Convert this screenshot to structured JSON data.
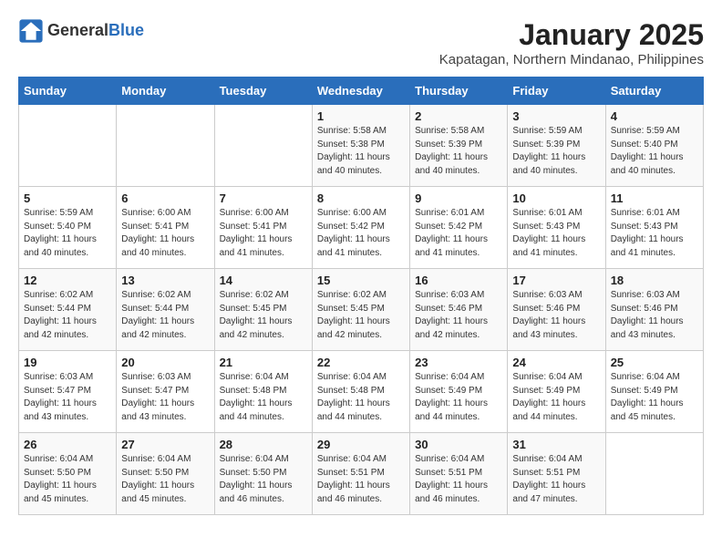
{
  "header": {
    "logo_general": "General",
    "logo_blue": "Blue",
    "title": "January 2025",
    "subtitle": "Kapatagan, Northern Mindanao, Philippines"
  },
  "days_of_week": [
    "Sunday",
    "Monday",
    "Tuesday",
    "Wednesday",
    "Thursday",
    "Friday",
    "Saturday"
  ],
  "weeks": [
    [
      {
        "day": "",
        "info": ""
      },
      {
        "day": "",
        "info": ""
      },
      {
        "day": "",
        "info": ""
      },
      {
        "day": "1",
        "info": "Sunrise: 5:58 AM\nSunset: 5:38 PM\nDaylight: 11 hours\nand 40 minutes."
      },
      {
        "day": "2",
        "info": "Sunrise: 5:58 AM\nSunset: 5:39 PM\nDaylight: 11 hours\nand 40 minutes."
      },
      {
        "day": "3",
        "info": "Sunrise: 5:59 AM\nSunset: 5:39 PM\nDaylight: 11 hours\nand 40 minutes."
      },
      {
        "day": "4",
        "info": "Sunrise: 5:59 AM\nSunset: 5:40 PM\nDaylight: 11 hours\nand 40 minutes."
      }
    ],
    [
      {
        "day": "5",
        "info": "Sunrise: 5:59 AM\nSunset: 5:40 PM\nDaylight: 11 hours\nand 40 minutes."
      },
      {
        "day": "6",
        "info": "Sunrise: 6:00 AM\nSunset: 5:41 PM\nDaylight: 11 hours\nand 40 minutes."
      },
      {
        "day": "7",
        "info": "Sunrise: 6:00 AM\nSunset: 5:41 PM\nDaylight: 11 hours\nand 41 minutes."
      },
      {
        "day": "8",
        "info": "Sunrise: 6:00 AM\nSunset: 5:42 PM\nDaylight: 11 hours\nand 41 minutes."
      },
      {
        "day": "9",
        "info": "Sunrise: 6:01 AM\nSunset: 5:42 PM\nDaylight: 11 hours\nand 41 minutes."
      },
      {
        "day": "10",
        "info": "Sunrise: 6:01 AM\nSunset: 5:43 PM\nDaylight: 11 hours\nand 41 minutes."
      },
      {
        "day": "11",
        "info": "Sunrise: 6:01 AM\nSunset: 5:43 PM\nDaylight: 11 hours\nand 41 minutes."
      }
    ],
    [
      {
        "day": "12",
        "info": "Sunrise: 6:02 AM\nSunset: 5:44 PM\nDaylight: 11 hours\nand 42 minutes."
      },
      {
        "day": "13",
        "info": "Sunrise: 6:02 AM\nSunset: 5:44 PM\nDaylight: 11 hours\nand 42 minutes."
      },
      {
        "day": "14",
        "info": "Sunrise: 6:02 AM\nSunset: 5:45 PM\nDaylight: 11 hours\nand 42 minutes."
      },
      {
        "day": "15",
        "info": "Sunrise: 6:02 AM\nSunset: 5:45 PM\nDaylight: 11 hours\nand 42 minutes."
      },
      {
        "day": "16",
        "info": "Sunrise: 6:03 AM\nSunset: 5:46 PM\nDaylight: 11 hours\nand 42 minutes."
      },
      {
        "day": "17",
        "info": "Sunrise: 6:03 AM\nSunset: 5:46 PM\nDaylight: 11 hours\nand 43 minutes."
      },
      {
        "day": "18",
        "info": "Sunrise: 6:03 AM\nSunset: 5:46 PM\nDaylight: 11 hours\nand 43 minutes."
      }
    ],
    [
      {
        "day": "19",
        "info": "Sunrise: 6:03 AM\nSunset: 5:47 PM\nDaylight: 11 hours\nand 43 minutes."
      },
      {
        "day": "20",
        "info": "Sunrise: 6:03 AM\nSunset: 5:47 PM\nDaylight: 11 hours\nand 43 minutes."
      },
      {
        "day": "21",
        "info": "Sunrise: 6:04 AM\nSunset: 5:48 PM\nDaylight: 11 hours\nand 44 minutes."
      },
      {
        "day": "22",
        "info": "Sunrise: 6:04 AM\nSunset: 5:48 PM\nDaylight: 11 hours\nand 44 minutes."
      },
      {
        "day": "23",
        "info": "Sunrise: 6:04 AM\nSunset: 5:49 PM\nDaylight: 11 hours\nand 44 minutes."
      },
      {
        "day": "24",
        "info": "Sunrise: 6:04 AM\nSunset: 5:49 PM\nDaylight: 11 hours\nand 44 minutes."
      },
      {
        "day": "25",
        "info": "Sunrise: 6:04 AM\nSunset: 5:49 PM\nDaylight: 11 hours\nand 45 minutes."
      }
    ],
    [
      {
        "day": "26",
        "info": "Sunrise: 6:04 AM\nSunset: 5:50 PM\nDaylight: 11 hours\nand 45 minutes."
      },
      {
        "day": "27",
        "info": "Sunrise: 6:04 AM\nSunset: 5:50 PM\nDaylight: 11 hours\nand 45 minutes."
      },
      {
        "day": "28",
        "info": "Sunrise: 6:04 AM\nSunset: 5:50 PM\nDaylight: 11 hours\nand 46 minutes."
      },
      {
        "day": "29",
        "info": "Sunrise: 6:04 AM\nSunset: 5:51 PM\nDaylight: 11 hours\nand 46 minutes."
      },
      {
        "day": "30",
        "info": "Sunrise: 6:04 AM\nSunset: 5:51 PM\nDaylight: 11 hours\nand 46 minutes."
      },
      {
        "day": "31",
        "info": "Sunrise: 6:04 AM\nSunset: 5:51 PM\nDaylight: 11 hours\nand 47 minutes."
      },
      {
        "day": "",
        "info": ""
      }
    ]
  ]
}
